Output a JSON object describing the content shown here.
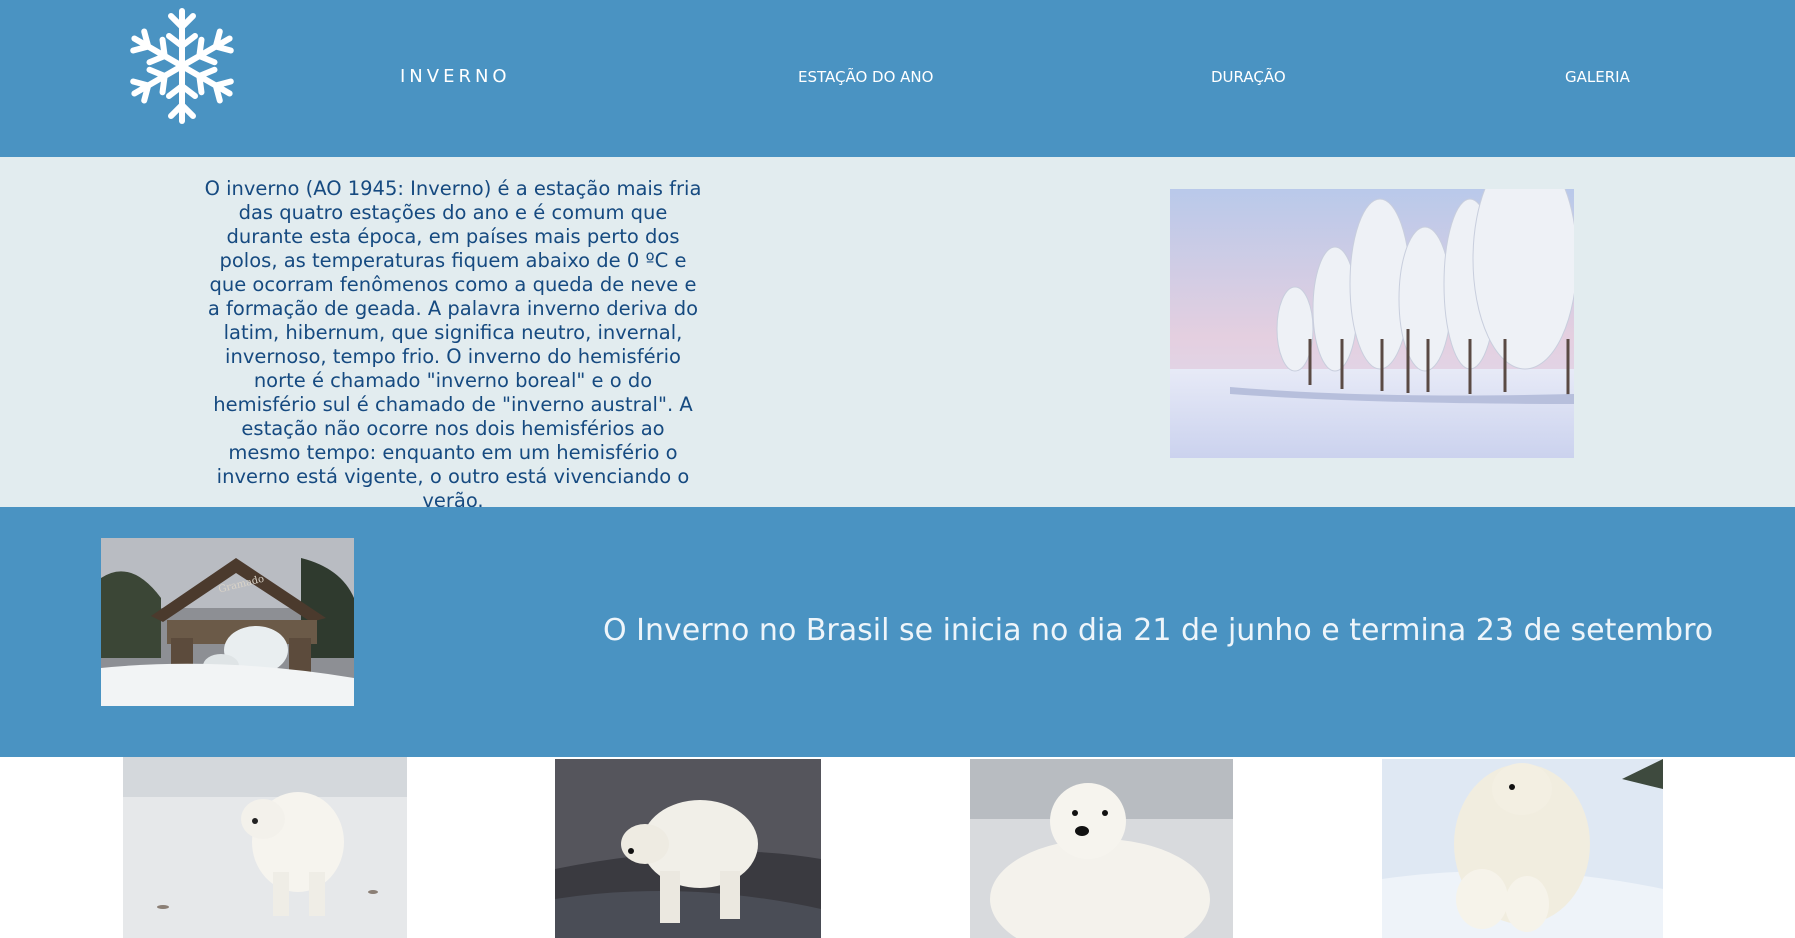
{
  "nav": {
    "brand": "INVERNO",
    "items": [
      "ESTAÇÃO DO ANO",
      "DURAÇÃO",
      "GALERIA"
    ]
  },
  "intro": {
    "text": "O inverno (AO 1945: Inverno) é a estação mais fria das quatro estações do ano e é comum que durante esta época, em países mais perto dos polos, as temperaturas fiquem abaixo de 0 ºC e que ocorram fenômenos como a queda de neve e a formação de geada. A palavra inverno deriva do latim, hibernum, que significa neutro, invernal, invernoso, tempo frio. O inverno do hemisfério norte é chamado \"inverno boreal\" e o do hemisfério sul é chamado de \"inverno austral\". A estação não ocorre nos dois hemisférios ao mesmo tempo: enquanto em um hemisfério o inverno está vigente, o outro está vivenciando o verão."
  },
  "brasil": {
    "text": "O Inverno no Brasil se inicia no dia 21 de junho e termina 23 de setembro",
    "sign_text": "Gramado"
  },
  "colors": {
    "header_bg": "#4a93c2",
    "intro_bg": "#e2ecef",
    "intro_text": "#164a80"
  },
  "icons": [
    "snowflake-icon"
  ]
}
